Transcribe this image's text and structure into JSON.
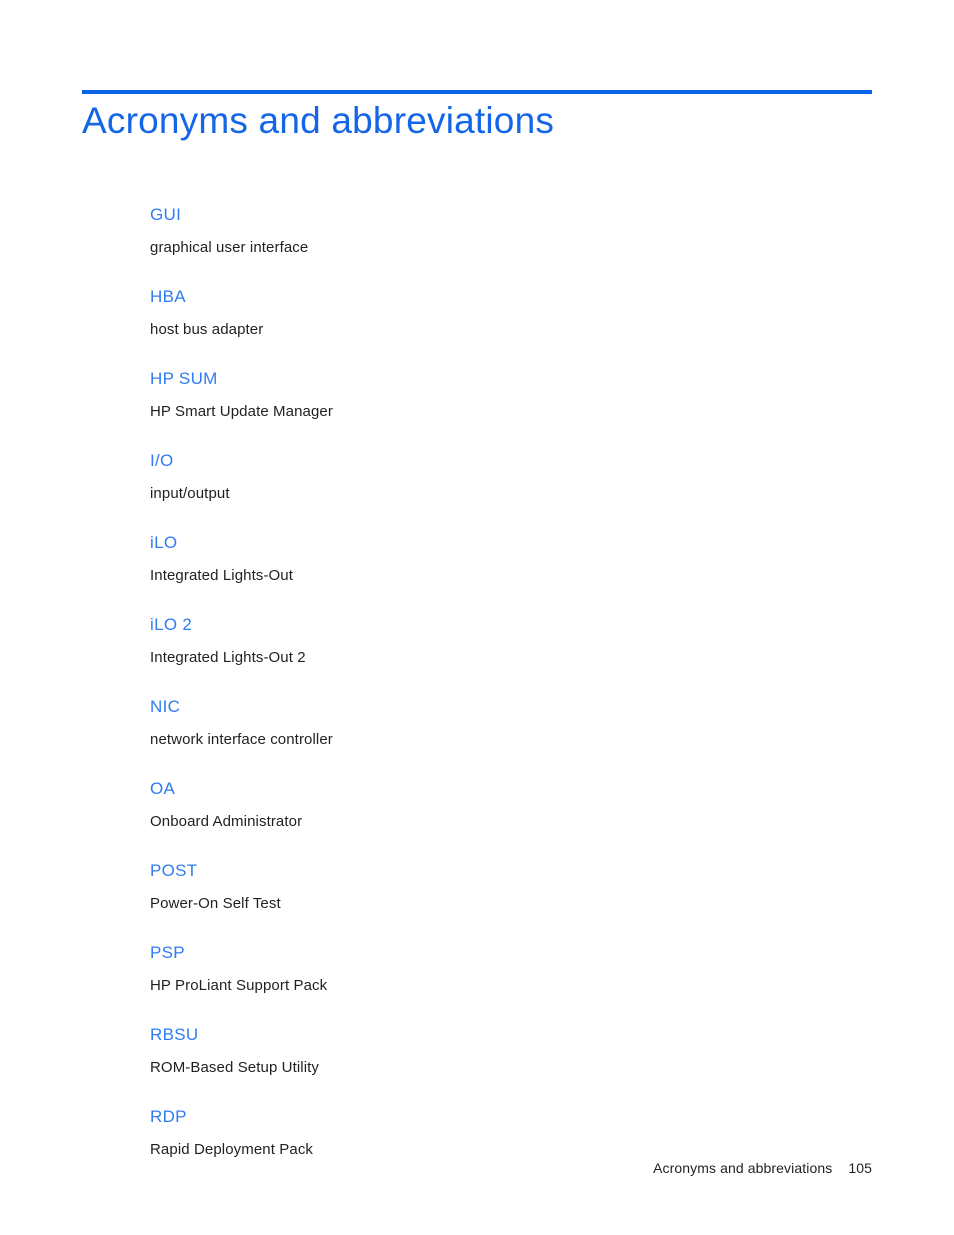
{
  "document": {
    "title": "Acronyms and abbreviations",
    "accent_color": "#0a64e8",
    "term_color": "#2f7cf0",
    "body_color": "#231f20"
  },
  "entries": [
    {
      "term": "GUI",
      "definition": "graphical user interface"
    },
    {
      "term": "HBA",
      "definition": "host bus adapter"
    },
    {
      "term": "HP SUM",
      "definition": "HP Smart Update Manager"
    },
    {
      "term": "I/O",
      "definition": "input/output"
    },
    {
      "term": "iLO",
      "definition": "Integrated Lights-Out"
    },
    {
      "term": "iLO 2",
      "definition": "Integrated Lights-Out 2"
    },
    {
      "term": "NIC",
      "definition": "network interface controller"
    },
    {
      "term": "OA",
      "definition": "Onboard Administrator"
    },
    {
      "term": "POST",
      "definition": "Power-On Self Test"
    },
    {
      "term": "PSP",
      "definition": "HP ProLiant Support Pack"
    },
    {
      "term": "RBSU",
      "definition": "ROM-Based Setup Utility"
    },
    {
      "term": "RDP",
      "definition": "Rapid Deployment Pack"
    }
  ],
  "footer": {
    "chapter": "Acronyms and abbreviations",
    "page_number": "105"
  }
}
